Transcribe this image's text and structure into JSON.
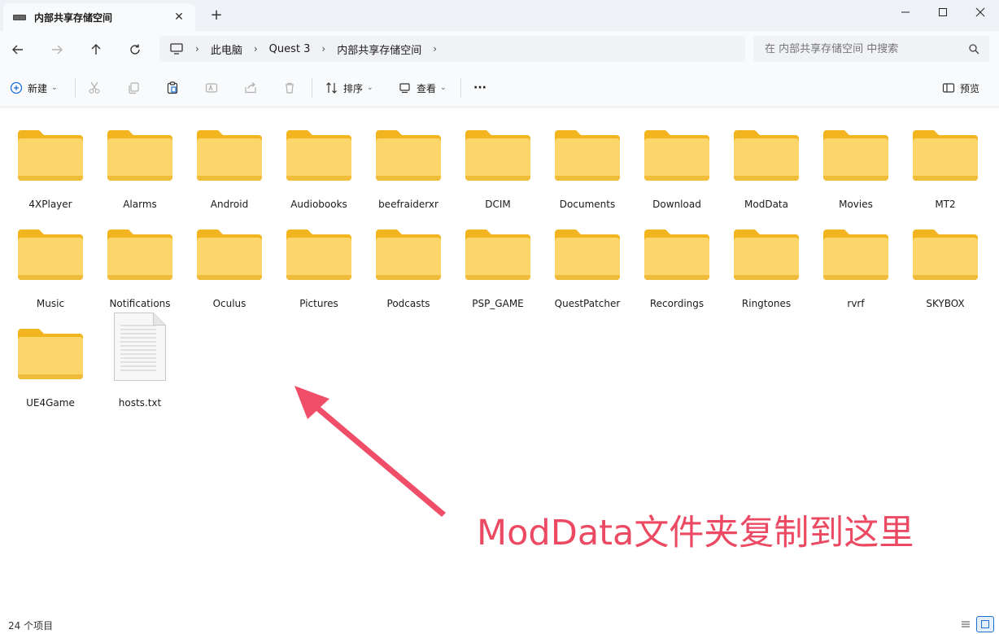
{
  "window": {
    "tab_title": "内部共享存储空间",
    "new_tab_glyph": "+",
    "close_glyph": "✕"
  },
  "breadcrumb": [
    "此电脑",
    "Quest 3",
    "内部共享存储空间"
  ],
  "search": {
    "placeholder": "在 内部共享存储空间 中搜索"
  },
  "toolbar": {
    "new_label": "新建",
    "sort_label": "排序",
    "view_label": "查看",
    "more_label": "···",
    "preview_label": "预览"
  },
  "items": [
    {
      "name": "4XPlayer",
      "type": "folder"
    },
    {
      "name": "Alarms",
      "type": "folder"
    },
    {
      "name": "Android",
      "type": "folder"
    },
    {
      "name": "Audiobooks",
      "type": "folder"
    },
    {
      "name": "beefraiderxr",
      "type": "folder"
    },
    {
      "name": "DCIM",
      "type": "folder"
    },
    {
      "name": "Documents",
      "type": "folder"
    },
    {
      "name": "Download",
      "type": "folder"
    },
    {
      "name": "ModData",
      "type": "folder"
    },
    {
      "name": "Movies",
      "type": "folder"
    },
    {
      "name": "MT2",
      "type": "folder"
    },
    {
      "name": "Music",
      "type": "folder"
    },
    {
      "name": "Notifications",
      "type": "folder"
    },
    {
      "name": "Oculus",
      "type": "folder"
    },
    {
      "name": "Pictures",
      "type": "folder"
    },
    {
      "name": "Podcasts",
      "type": "folder"
    },
    {
      "name": "PSP_GAME",
      "type": "folder"
    },
    {
      "name": "QuestPatcher",
      "type": "folder"
    },
    {
      "name": "Recordings",
      "type": "folder"
    },
    {
      "name": "Ringtones",
      "type": "folder"
    },
    {
      "name": "rvrf",
      "type": "folder"
    },
    {
      "name": "SKYBOX",
      "type": "folder"
    },
    {
      "name": "UE4Game",
      "type": "folder"
    },
    {
      "name": "hosts.txt",
      "type": "file"
    }
  ],
  "annotation": {
    "text": "ModData文件夹复制到这里",
    "color": "#ec4a63"
  },
  "status": {
    "count_text": "24 个项目"
  },
  "colors": {
    "folder_front": "#fcd66a",
    "folder_back": "#f2b51f",
    "accent": "#1f6fd1"
  }
}
